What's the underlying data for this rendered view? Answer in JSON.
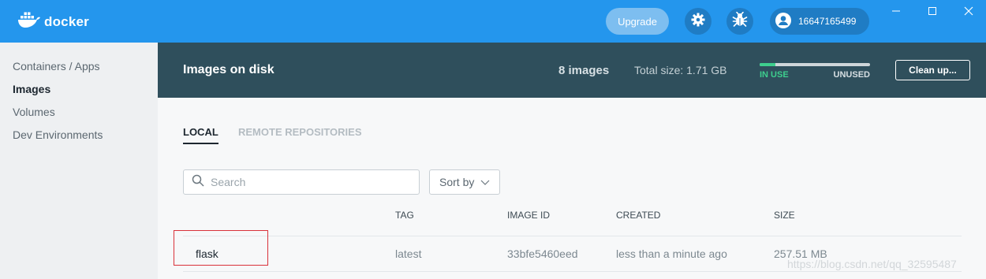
{
  "app": {
    "logo_text": "docker",
    "upgrade_label": "Upgrade",
    "account_label": "16647165499",
    "brand_color": "#2496ed"
  },
  "sidebar": {
    "items": [
      {
        "label": "Containers / Apps",
        "active": false
      },
      {
        "label": "Images",
        "active": true
      },
      {
        "label": "Volumes",
        "active": false
      },
      {
        "label": "Dev Environments",
        "active": false
      }
    ]
  },
  "header": {
    "title": "Images on disk",
    "image_count": "8 images",
    "total_size": "Total size: 1.71 GB",
    "in_use_label": "IN USE",
    "unused_label": "UNUSED",
    "cleanup_label": "Clean up...",
    "usage_fraction": 0.14
  },
  "tabs": [
    {
      "label": "LOCAL",
      "active": true
    },
    {
      "label": "REMOTE REPOSITORIES",
      "active": false
    }
  ],
  "search": {
    "placeholder": "Search",
    "value": ""
  },
  "sort": {
    "label": "Sort by"
  },
  "table": {
    "columns": [
      "TAG",
      "IMAGE ID",
      "CREATED",
      "SIZE"
    ],
    "rows": [
      {
        "name": "flask",
        "tag": "latest",
        "image_id": "33bfe5460eed",
        "created": "less than a minute ago",
        "size": "257.51 MB"
      }
    ]
  },
  "watermark": "https://blog.csdn.net/qq_32595487",
  "icons": [
    "docker-whale-icon",
    "gear-icon",
    "bug-icon",
    "account-icon",
    "search-icon",
    "chevron-down-icon",
    "minimize-icon",
    "maximize-icon",
    "close-icon"
  ]
}
